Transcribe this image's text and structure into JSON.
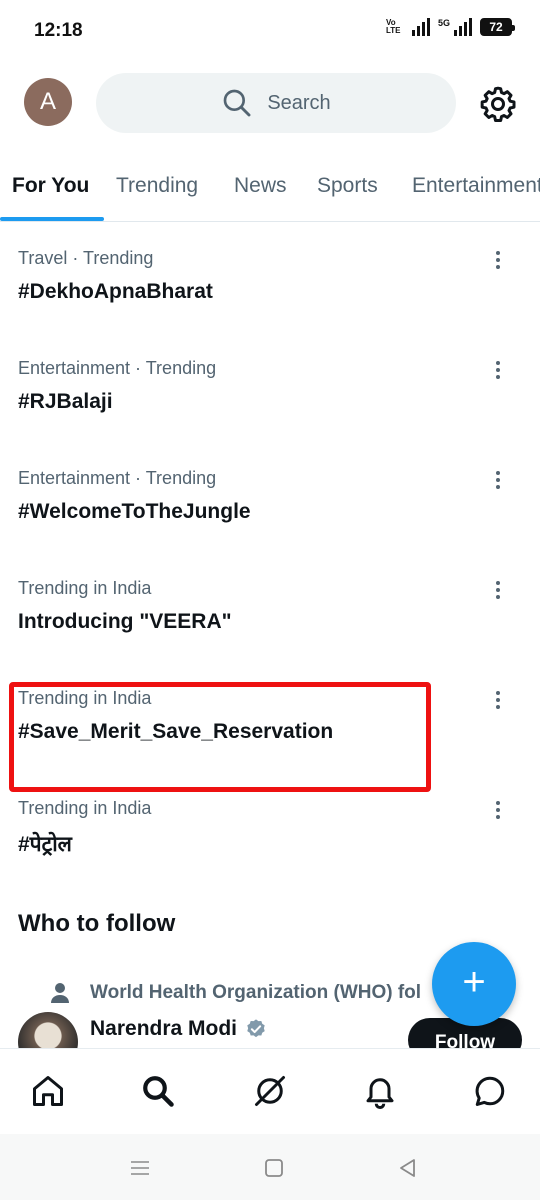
{
  "status": {
    "time": "12:18",
    "volte": "Vo LTE",
    "net": "5G",
    "battery": "72"
  },
  "header": {
    "avatar_letter": "A",
    "search_placeholder": "Search"
  },
  "tabs": [
    {
      "label": "For You"
    },
    {
      "label": "Trending"
    },
    {
      "label": "News"
    },
    {
      "label": "Sports"
    },
    {
      "label": "Entertainment"
    }
  ],
  "trends": [
    {
      "meta": "Travel · Trending",
      "title": "#DekhoApnaBharat"
    },
    {
      "meta": "Entertainment · Trending",
      "title": "#RJBalaji"
    },
    {
      "meta": "Entertainment · Trending",
      "title": "#WelcomeToTheJungle"
    },
    {
      "meta": "Trending in India",
      "title": "Introducing \"VEERA\""
    },
    {
      "meta": "Trending in India",
      "title": "#Save_Merit_Save_Reservation"
    },
    {
      "meta": "Trending in India",
      "title": "#पेट्रोल"
    }
  ],
  "who_to_follow": {
    "title": "Who to follow",
    "followed_by": "World Health Organization (WHO) fol",
    "name": "Narendra Modi",
    "follow_label": "Follow"
  },
  "fab_label": "+",
  "colors": {
    "accent": "#1d9bf0",
    "highlight": "#ee1111",
    "text": "#0f1419",
    "muted": "#536471"
  },
  "icons": {
    "bottom_nav": [
      "home-icon",
      "search-icon",
      "grok-icon",
      "bell-icon",
      "message-icon"
    ],
    "system_nav": [
      "recents-icon",
      "home-square-icon",
      "back-icon"
    ]
  }
}
